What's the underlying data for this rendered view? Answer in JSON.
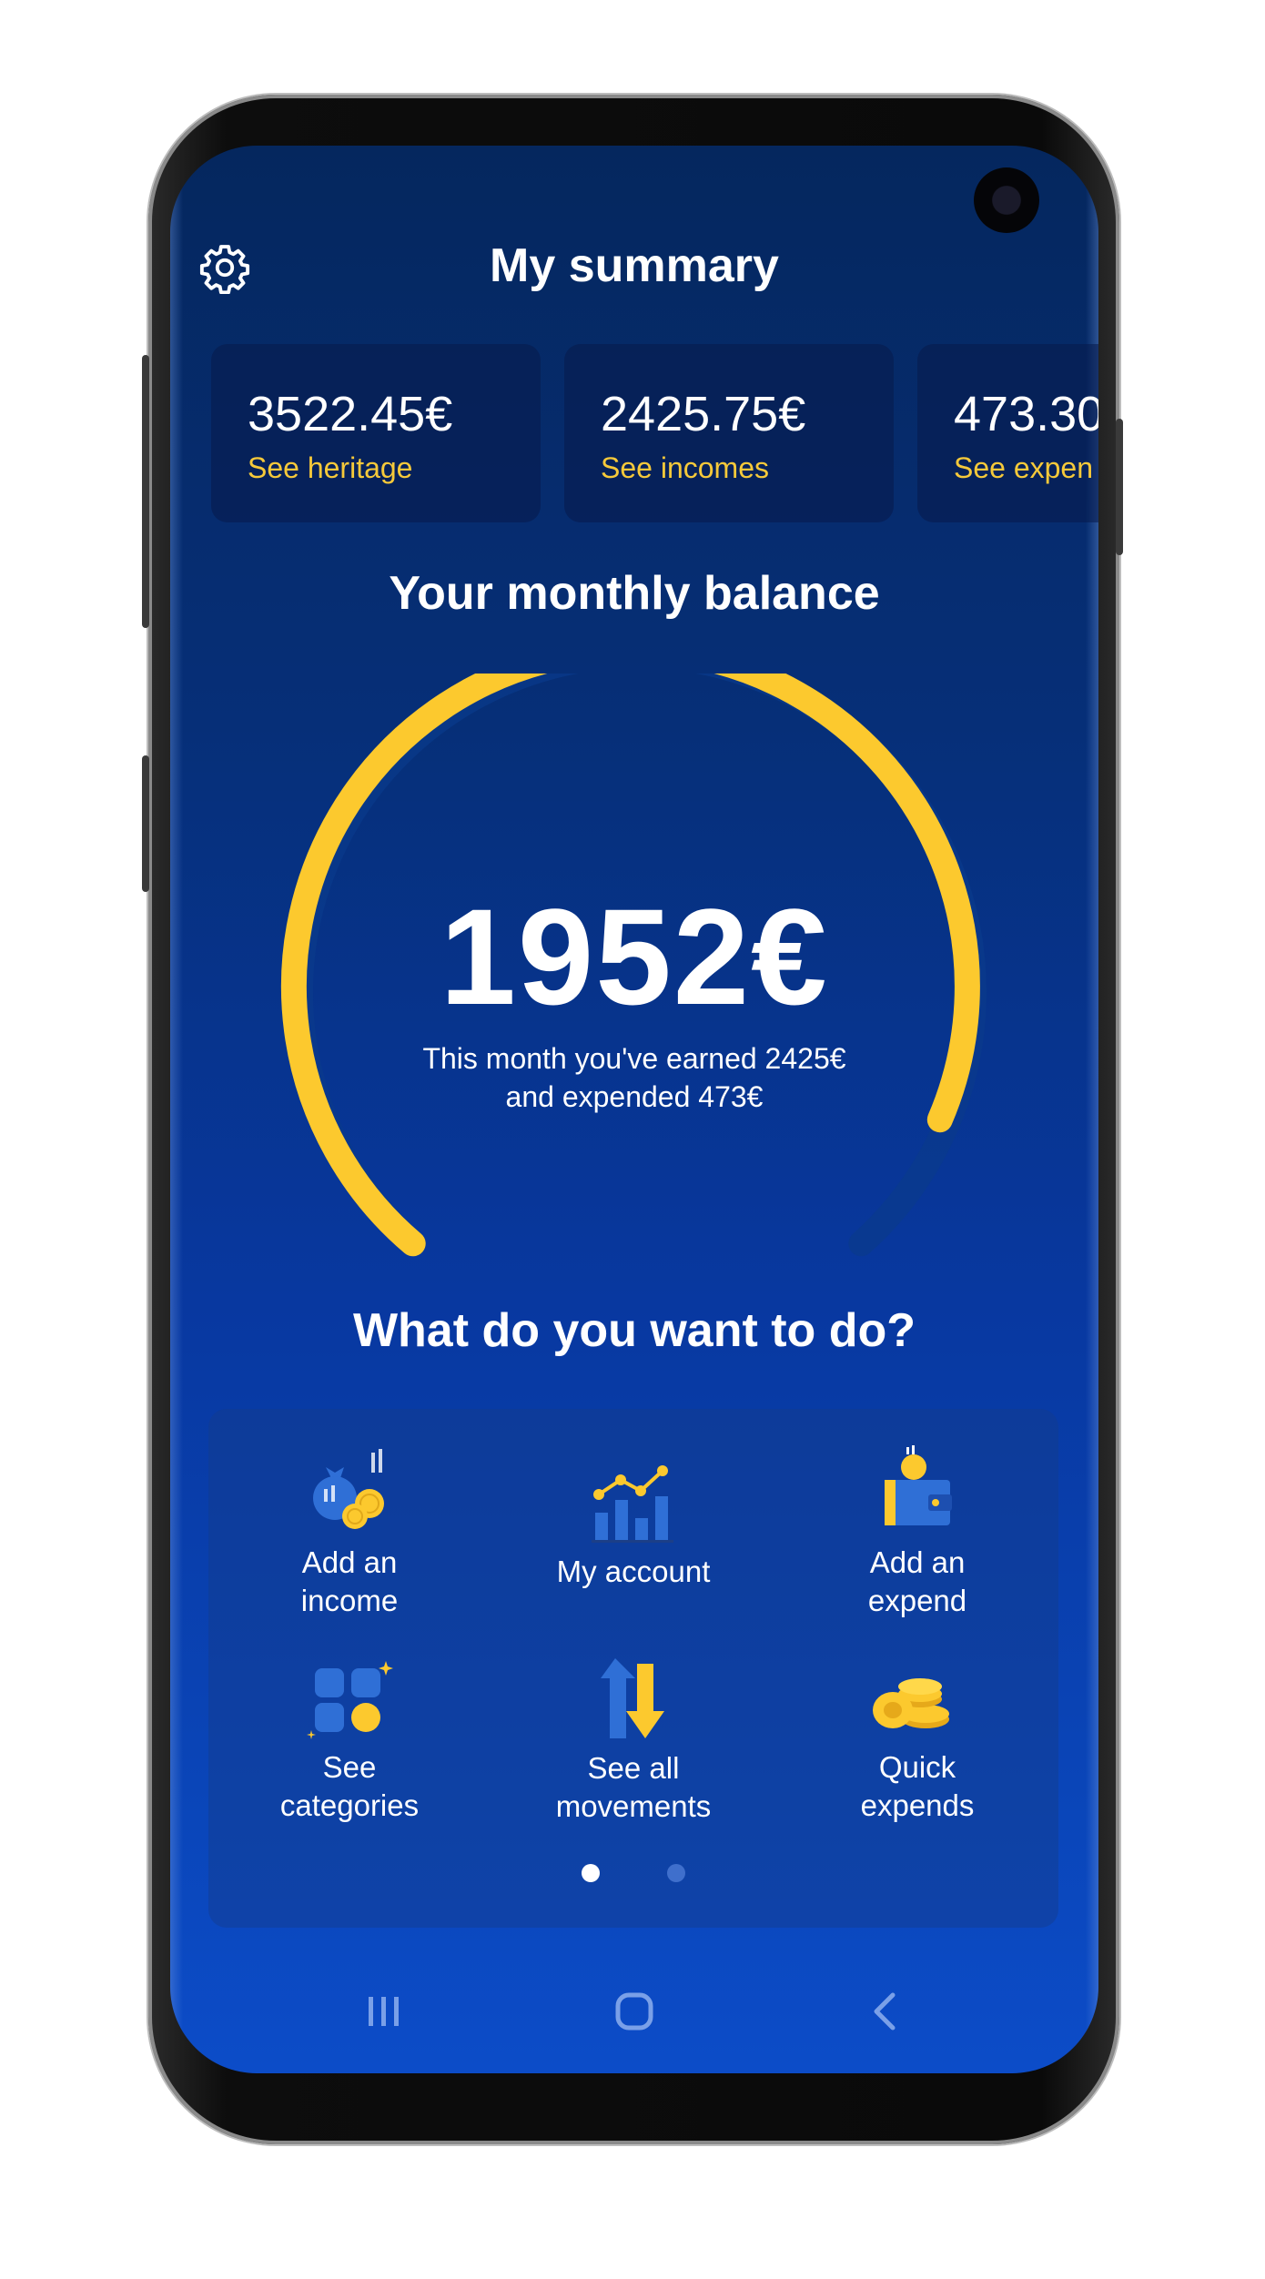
{
  "header": {
    "title": "My summary"
  },
  "summary_cards": [
    {
      "amount": "3522.45€",
      "link": "See heritage"
    },
    {
      "amount": "2425.75€",
      "link": "See incomes"
    },
    {
      "amount": "473.30",
      "link": "See expen"
    }
  ],
  "balance": {
    "title": "Your monthly balance",
    "amount": "1952€",
    "line1": "This month you've earned 2425€",
    "line2": "and expended 473€"
  },
  "actions": {
    "title": "What do you want to do?",
    "items": [
      {
        "line1": "Add an",
        "line2": "income",
        "icon": "money-bag-icon"
      },
      {
        "line1": "My account",
        "line2": "",
        "icon": "chart-icon"
      },
      {
        "line1": "Add an",
        "line2": "expend",
        "icon": "wallet-icon"
      },
      {
        "line1": "See",
        "line2": "categories",
        "icon": "categories-icon"
      },
      {
        "line1": "See all",
        "line2": "movements",
        "icon": "movements-icon"
      },
      {
        "line1": "Quick",
        "line2": "expends",
        "icon": "coins-icon"
      }
    ],
    "pager": {
      "pages": 2,
      "active": 1
    }
  },
  "navigation": {
    "icons": [
      "recent-apps-icon",
      "home-icon",
      "back-icon"
    ]
  },
  "colors": {
    "accent": "#f6c93a",
    "background": "#062f78",
    "text": "#ffffff"
  }
}
